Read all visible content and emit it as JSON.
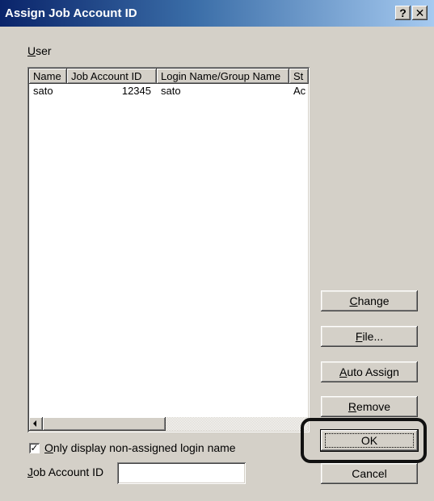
{
  "window": {
    "title": "Assign Job Account ID",
    "help_glyph": "?",
    "close_glyph": "✕"
  },
  "user_group": {
    "label_accel": "U",
    "label_rest": "ser"
  },
  "list": {
    "columns": [
      "Name",
      "Job Account ID",
      "Login Name/Group Name",
      "St"
    ],
    "rows": [
      {
        "name": "sato",
        "job_account_id": "12345",
        "login": "sato",
        "status": "Ac"
      }
    ]
  },
  "buttons": {
    "change": {
      "accel": "C",
      "rest": "hange"
    },
    "file": {
      "accel": "F",
      "rest": "ile..."
    },
    "auto_assign": {
      "accel": "A",
      "rest": "uto Assign"
    },
    "remove": {
      "accel": "R",
      "rest": "emove"
    },
    "ok": {
      "label": "OK"
    },
    "cancel": {
      "label": "Cancel"
    }
  },
  "only_display": {
    "checked": true,
    "check_glyph": "✓",
    "accel": "O",
    "rest": "nly display non-assigned login name"
  },
  "job_account_field": {
    "accel": "J",
    "rest": "ob Account ID",
    "value": "",
    "placeholder": ""
  }
}
